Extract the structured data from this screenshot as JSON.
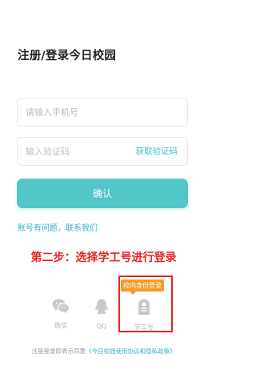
{
  "header": {
    "title": "注册/登录今日校园"
  },
  "form": {
    "phone_placeholder": "请输入手机号",
    "code_placeholder": "输入验证码",
    "get_code_label": "获取验证码",
    "confirm_label": "确认"
  },
  "help": {
    "link_label": "账号有问题，联系我们"
  },
  "annotation": {
    "step_text": "第二步：选择学工号进行登录"
  },
  "login_options": [
    {
      "label": "微信",
      "icon": "wechat-icon"
    },
    {
      "label": "QQ",
      "icon": "qq-icon"
    },
    {
      "label": "学工号",
      "icon": "student-id-icon"
    }
  ],
  "staff_tag": "校内身份登录",
  "agreement": {
    "prefix": "注册登录即表示同意",
    "link_label": "《今日校园使用协议和隐私政策》"
  },
  "colors": {
    "accent": "#52c6c8",
    "link": "#35b3c4",
    "annotation_red": "#e8231f",
    "tag_orange": "#f29d29"
  }
}
